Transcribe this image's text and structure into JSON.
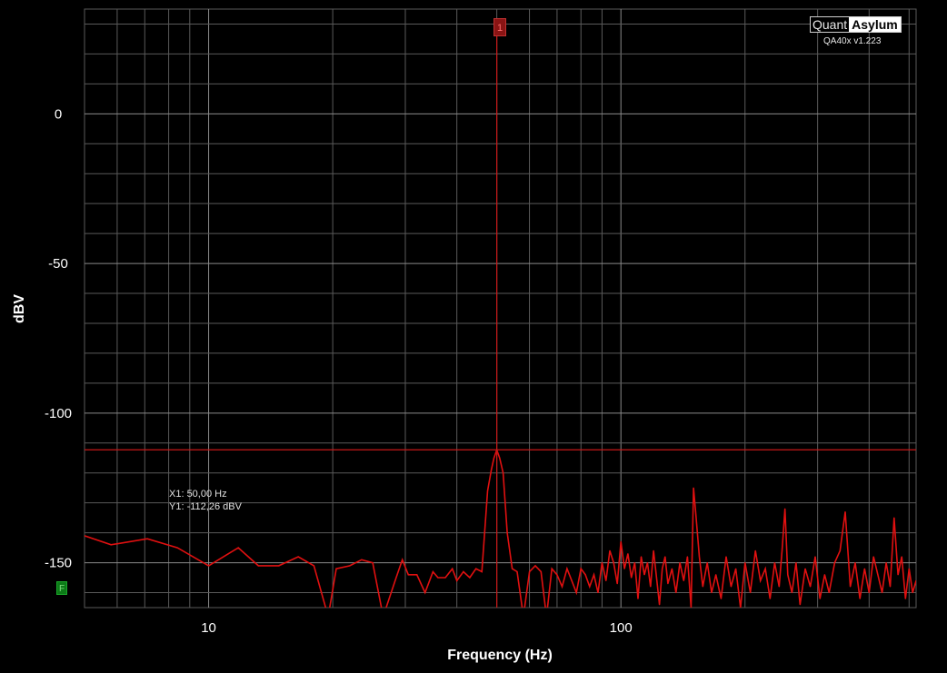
{
  "logo": {
    "quant": "Quant",
    "asylum": "Asylum"
  },
  "version": "QA40x v1.223",
  "cursor": {
    "x_text": "X1: 50,00 Hz",
    "y_text": "Y1: -112,26 dBV"
  },
  "marker_label": "1",
  "f_badge": "F",
  "colors": {
    "background": "#000000",
    "grid": "#5a5a5a",
    "trace": "#e01010",
    "marker": "#c81818",
    "text": "#ffffff"
  },
  "chart_data": {
    "type": "line",
    "title": "",
    "xlabel": "Frequency (Hz)",
    "ylabel": "dBV",
    "x_scale": "log",
    "xlim": [
      5,
      520
    ],
    "ylim": [
      -165,
      35
    ],
    "x_ticks": [
      {
        "value": 10,
        "label": "10"
      },
      {
        "value": 100,
        "label": "100"
      }
    ],
    "y_ticks": [
      {
        "value": 0,
        "label": "0"
      },
      {
        "value": -50,
        "label": "-50"
      },
      {
        "value": -100,
        "label": "-100"
      },
      {
        "value": -150,
        "label": "-150"
      }
    ],
    "grid": true,
    "cursor": {
      "x": 50,
      "y": -112.26
    },
    "series": [
      {
        "x": [
          5,
          5.8,
          7.1,
          8.4,
          10.0,
          11.8,
          13.2,
          14.8,
          16.5,
          18.0,
          19.5,
          20.4,
          22.0,
          23.5,
          25.0,
          26.5,
          28.5,
          29.5,
          30.5,
          32.0,
          33.5,
          35.0,
          36.0,
          37.5,
          39.0,
          40.0,
          41.5,
          43.0,
          44.5,
          46.0,
          47.5,
          48.5,
          49.2,
          50.0,
          50.8,
          51.8,
          53.0,
          54.5,
          56.0,
          58.0,
          60.0,
          62.0,
          64.0,
          66.0,
          68.0,
          70.0,
          72.0,
          74.0,
          76.0,
          78.0,
          80.0,
          82.0,
          84.0,
          86.0,
          88.0,
          90.0,
          92.0,
          94.0,
          96.0,
          98.0,
          100.0,
          102.0,
          104.0,
          106.0,
          108.0,
          110.0,
          112.0,
          114.0,
          116.0,
          118.0,
          120.0,
          122.0,
          124.0,
          126.0,
          128.0,
          130.0,
          133.0,
          136.0,
          139.0,
          142.0,
          145.0,
          148.0,
          150.0,
          152.0,
          155.0,
          158.0,
          162.0,
          166.0,
          170.0,
          175.0,
          180.0,
          185.0,
          190.0,
          195.0,
          200.0,
          206.0,
          212.0,
          218.0,
          224.0,
          230.0,
          236.0,
          242.0,
          246.0,
          250.0,
          254.0,
          260.0,
          266.0,
          272.0,
          280.0,
          288.0,
          296.0,
          304.0,
          312.0,
          320.0,
          330.0,
          340.0,
          350.0,
          360.0,
          370.0,
          380.0,
          390.0,
          400.0,
          410.0,
          420.0,
          430.0,
          440.0,
          450.0,
          460.0,
          470.0,
          480.0,
          490.0,
          500.0,
          510.0,
          520.0
        ],
        "y": [
          -141,
          -144,
          -142,
          -145,
          -151,
          -145,
          -151,
          -151,
          -148,
          -151,
          -168,
          -152,
          -151,
          -149,
          -150,
          -168,
          -155,
          -149,
          -154,
          -154,
          -160,
          -153,
          -155,
          -155,
          -152,
          -156,
          -153,
          -155,
          -152,
          -153,
          -126,
          -119,
          -115,
          -112.3,
          -115,
          -120,
          -140,
          -152,
          -153,
          -168,
          -153,
          -151,
          -153,
          -168,
          -152,
          -154,
          -158,
          -152,
          -156,
          -160,
          -152,
          -154,
          -158,
          -154,
          -160,
          -150,
          -156,
          -146,
          -150,
          -157,
          -143,
          -152,
          -147,
          -155,
          -150,
          -162,
          -148,
          -154,
          -150,
          -158,
          -146,
          -155,
          -164,
          -152,
          -148,
          -157,
          -152,
          -160,
          -150,
          -156,
          -148,
          -165,
          -125,
          -134,
          -148,
          -158,
          -150,
          -160,
          -154,
          -162,
          -148,
          -158,
          -152,
          -165,
          -150,
          -160,
          -146,
          -156,
          -152,
          -162,
          -150,
          -158,
          -146,
          -132,
          -154,
          -160,
          -150,
          -164,
          -152,
          -158,
          -148,
          -162,
          -154,
          -160,
          -150,
          -146,
          -133,
          -158,
          -150,
          -162,
          -152,
          -160,
          -148,
          -154,
          -160,
          -150,
          -158,
          -135,
          -154,
          -148,
          -162,
          -152,
          -160,
          -156
        ]
      }
    ]
  },
  "labels": {
    "x_axis": "Frequency (Hz)",
    "y_axis": "dBV"
  }
}
